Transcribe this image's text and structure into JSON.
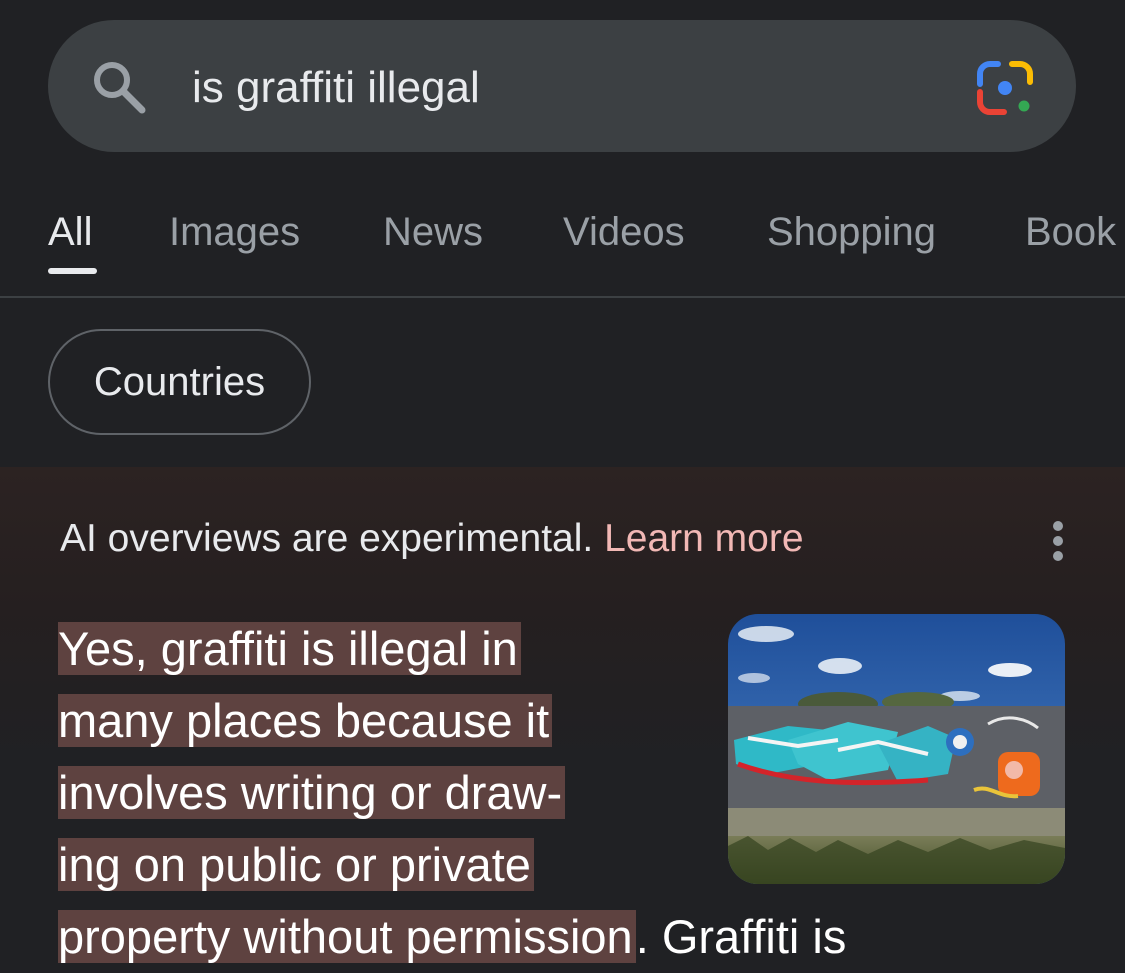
{
  "search": {
    "query": "is graffiti illegal"
  },
  "icons": {
    "search": "search-icon",
    "lens": "google-lens-icon",
    "more": "more-vertical-icon"
  },
  "tabs": [
    {
      "label": "All",
      "active": true
    },
    {
      "label": "Images",
      "active": false
    },
    {
      "label": "News",
      "active": false
    },
    {
      "label": "Videos",
      "active": false
    },
    {
      "label": "Shopping",
      "active": false
    },
    {
      "label": "Book",
      "active": false
    }
  ],
  "chips": [
    {
      "label": "Countries"
    }
  ],
  "ai_overview": {
    "notice": "AI overviews are experimental.",
    "learn_more": "Learn more",
    "answer_lines": [
      {
        "highlight": "Yes, graffiti is illegal in",
        "rest": ""
      },
      {
        "highlight": "many places because it",
        "rest": ""
      },
      {
        "highlight": "involves writing or draw-",
        "rest": ""
      },
      {
        "highlight": "ing on public or private",
        "rest": ""
      },
      {
        "highlight": "property without permission",
        "rest": ". Graffiti is"
      }
    ],
    "image_alt": "graffiti wall"
  },
  "colors": {
    "background": "#202124",
    "search_bar": "#3c4043",
    "highlight": "#5e4240",
    "link": "#f2b8b5",
    "muted_text": "#9aa0a6"
  }
}
